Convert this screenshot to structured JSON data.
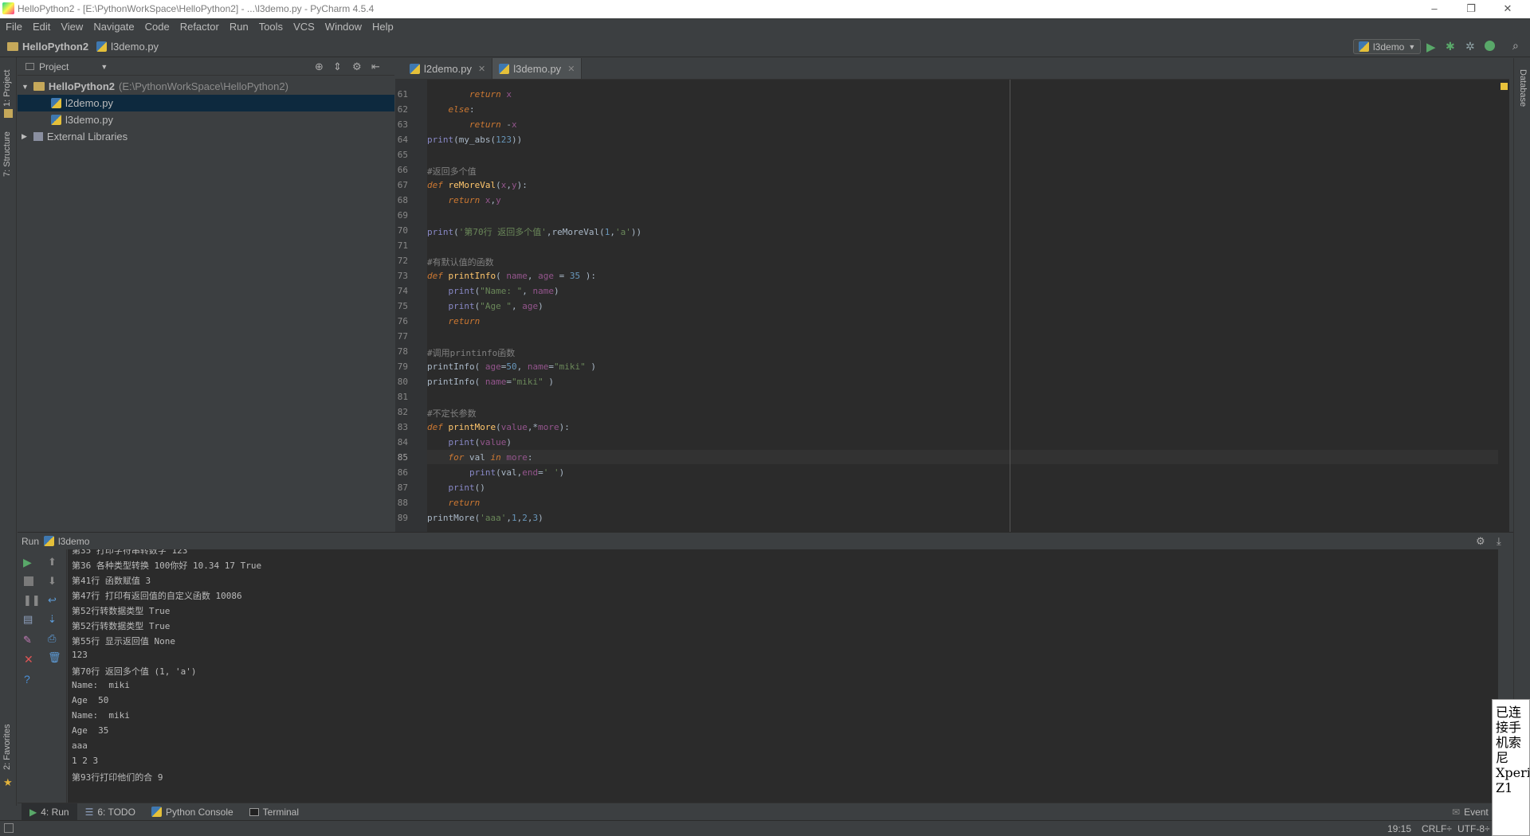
{
  "window": {
    "title": "HelloPython2 - [E:\\PythonWorkSpace\\HelloPython2] - ...\\l3demo.py - PyCharm 4.5.4",
    "minimize": "–",
    "restore": "❐",
    "close": "✕"
  },
  "menu": [
    "File",
    "Edit",
    "View",
    "Navigate",
    "Code",
    "Refactor",
    "Run",
    "Tools",
    "VCS",
    "Window",
    "Help"
  ],
  "nav": {
    "project": "HelloPython2",
    "file": "l3demo.py",
    "run_config": "l3demo"
  },
  "left_strip": {
    "project_tab": "1: Project",
    "structure_tab": "7: Structure",
    "favorites_tab": "2: Favorites"
  },
  "right_strip": {
    "database_tab": "Database"
  },
  "project_panel": {
    "header": "Project",
    "root_name": "HelloPython2",
    "root_path": "(E:\\PythonWorkSpace\\HelloPython2)",
    "files": [
      "l2demo.py",
      "l3demo.py"
    ],
    "external": "External Libraries"
  },
  "editor": {
    "tabs": [
      "l2demo.py",
      "l3demo.py"
    ],
    "active_tab": 1,
    "current_line": "85",
    "line_numbers": [
      "61",
      "62",
      "63",
      "64",
      "65",
      "66",
      "67",
      "68",
      "69",
      "70",
      "71",
      "72",
      "73",
      "74",
      "75",
      "76",
      "77",
      "78",
      "79",
      "80",
      "81",
      "82",
      "83",
      "84",
      "85",
      "86",
      "87",
      "88",
      "89"
    ]
  },
  "run_panel": {
    "title": "Run",
    "config": "l3demo",
    "output": [
      "第35 打印字符串转数字 123",
      "第36 各种类型转换 100你好 10.34 17 True",
      "第41行 函数赋值 3",
      "第47行 打印有返回值的自定义函数 10086",
      "第52行转数据类型 True",
      "第52行转数据类型 True",
      "第55行 显示返回值 None",
      "123",
      "第70行 返回多个值 (1, 'a')",
      "Name:  miki",
      "Age  50",
      "Name:  miki",
      "Age  35",
      "aaa",
      "1 2 3",
      "第93行打印他们的合 9"
    ]
  },
  "bottom_tabs": [
    "4: Run",
    "6: TODO",
    "Python Console",
    "Terminal"
  ],
  "status": {
    "event_log": "Event",
    "position": "19:15",
    "line_sep": "CRLF÷",
    "encoding": "UTF-8÷"
  },
  "toast": {
    "text": "已连接手机索尼Xperi Z1"
  }
}
